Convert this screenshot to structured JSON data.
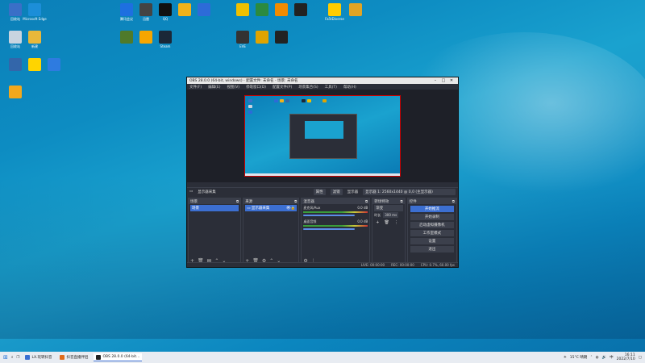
{
  "desktop": {
    "icons": [
      {
        "label": "回收站",
        "color": "#3a6fc7"
      },
      {
        "label": "Microsoft Edge",
        "color": "#1c8ed8"
      },
      {
        "label": "回收站",
        "color": "#c9d4e0"
      },
      {
        "label": "新建",
        "color": "#e8b83a"
      },
      {
        "label": "腾讯会议",
        "color": "#1e6fe0"
      },
      {
        "label": "迅雷",
        "color": "#444"
      },
      {
        "label": "QQ",
        "color": "#111"
      },
      {
        "label": "",
        "color": "#f2b21a"
      },
      {
        "label": "",
        "color": "#2d6bd8"
      },
      {
        "label": "Fa5tDiverse",
        "color": "#ffcc00"
      },
      {
        "label": "",
        "color": "#e1a425"
      },
      {
        "label": "",
        "color": "#3366aa"
      },
      {
        "label": "",
        "color": "#ffd400"
      },
      {
        "label": "",
        "color": "#2e7be0"
      },
      {
        "label": "",
        "color": "#4f7a2a"
      },
      {
        "label": "",
        "color": "#f7a600"
      },
      {
        "label": "Steam",
        "color": "#1b2838"
      },
      {
        "label": "",
        "color": "#f0c000"
      },
      {
        "label": "",
        "color": "#2b8a3e"
      },
      {
        "label": "",
        "color": "#f28b00"
      },
      {
        "label": "",
        "color": "#222"
      },
      {
        "label": "EVE",
        "color": "#333"
      },
      {
        "label": "",
        "color": "#e0a400"
      },
      {
        "label": "",
        "color": "#222"
      }
    ]
  },
  "obs": {
    "title": "OBS 28.0.0 (64-bit, windows) - 配置文件: 未命名 - 场景: 未命名",
    "menu": [
      "文件(F)",
      "编辑(E)",
      "视图(V)",
      "停靠窗口(D)",
      "配置文件(P)",
      "场景集合(S)",
      "工具(T)",
      "帮助(H)"
    ],
    "source_bar": {
      "source": "显示器采集",
      "properties": "属性",
      "filters": "滤镜",
      "display": "显示器",
      "display_value": "显示器 1: 2560x1440 @ 0,0 (主显示器)"
    },
    "docks": {
      "scenes": {
        "title": "场景",
        "items": [
          "场景"
        ]
      },
      "sources": {
        "title": "来源",
        "items": [
          "显示器采集"
        ]
      },
      "mixer": {
        "title": "混音器",
        "channels": [
          {
            "name": "麦克风/Aux",
            "level": "0.0 dB"
          },
          {
            "name": "桌面音频",
            "level": "0.0 dB"
          }
        ]
      },
      "transitions": {
        "title": "转场特效",
        "type": "渐变",
        "duration_label": "时长",
        "duration": "300 ms"
      },
      "controls": {
        "title": "控件",
        "buttons": [
          "开始推流",
          "开始录制",
          "启动虚拟摄像机",
          "工作室模式",
          "设置",
          "退出"
        ]
      }
    },
    "status": {
      "live": "LIVE: 00:00:00",
      "rec": "REC: 00:00:00",
      "cpu": "CPU: 0.7%, 60.00 fps"
    }
  },
  "taskbar": {
    "items": [
      {
        "label": "LX.玩转抖音",
        "color": "#3c6fd1"
      },
      {
        "label": "抖音直播伴侣",
        "color": "#e06a1a"
      },
      {
        "label": "OBS 28.0.0 (64-bit...",
        "color": "#222"
      }
    ],
    "weather": "15°C 晴朗",
    "ime": "中",
    "time": "16:11",
    "date": "2022/7/10"
  }
}
